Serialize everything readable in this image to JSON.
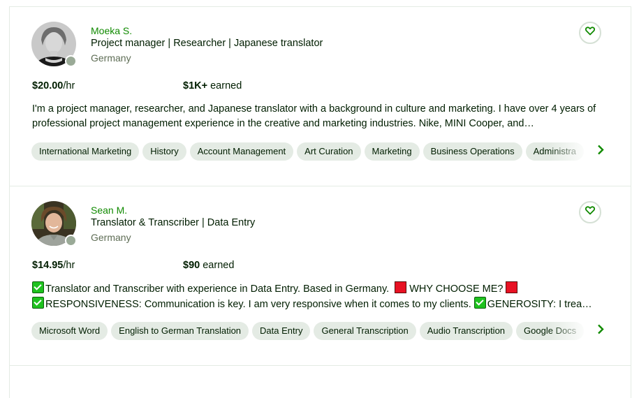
{
  "freelancers": [
    {
      "name": "Moeka S.",
      "title": "Project manager | Researcher | Japanese translator",
      "location": "Germany",
      "rate_amount": "$20.00",
      "rate_unit": "/hr",
      "earned_amount": "$1K+",
      "earned_label": " earned",
      "description": "I'm a project manager, researcher, and Japanese translator with a background in culture and marketing. I have over 4 years of professional project management experience in the creative and marketing industries. Nike, MINI Cooper, and…",
      "skills": [
        "International Marketing",
        "History",
        "Account Management",
        "Art Curation",
        "Marketing",
        "Business Operations",
        "Administra"
      ],
      "favorite_icon": "heart-outline-icon",
      "next_icon": "chevron-right-icon"
    },
    {
      "name": "Sean M.",
      "title": "Translator & Transcriber | Data Entry",
      "location": "Germany",
      "rate_amount": "$14.95",
      "rate_unit": "/hr",
      "earned_amount": "$90",
      "earned_label": " earned",
      "description_parts": {
        "p1": "Translator and Transcriber with experience in Data Entry. Based in Germany.",
        "p2": "WHY CHOOSE ME?",
        "p3": "RESPONSIVENESS: Communication is key. I am very responsive when it comes to my clients.",
        "p4": "GENEROSITY: I trea…"
      },
      "skills": [
        "Microsoft Word",
        "English to German Translation",
        "Data Entry",
        "General Transcription",
        "Audio Transcription",
        "Google Docs"
      ],
      "favorite_icon": "heart-outline-icon",
      "next_icon": "chevron-right-icon"
    }
  ],
  "colors": {
    "accent_green": "#108a00",
    "chip_bg": "#e4ebe4",
    "status_dot": "#9aaa97"
  }
}
